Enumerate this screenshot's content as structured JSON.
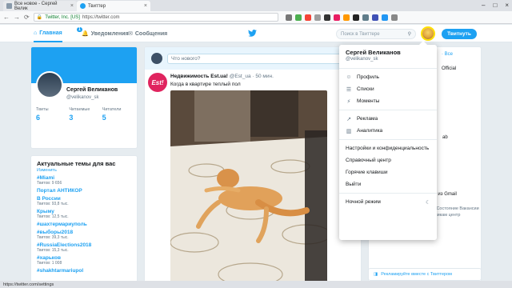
{
  "browser": {
    "tabs": [
      {
        "title": "Все новое - Сергей Велик",
        "active": false
      },
      {
        "title": "Твиттер",
        "active": true
      }
    ],
    "url_org": "Twitter, Inc. [US]",
    "url_path": "https://twitter.com"
  },
  "topnav": {
    "home": "Главная",
    "notifications": "Уведомления",
    "notifications_count": "1",
    "messages": "Сообщения",
    "search_placeholder": "Поиск в Твиттере",
    "tweet_button": "Твитнуть"
  },
  "profile": {
    "name": "Сергей Великанов",
    "handle": "@velikanov_sk",
    "stats": [
      {
        "label": "Твиты",
        "value": "6"
      },
      {
        "label": "Читаемые",
        "value": "3"
      },
      {
        "label": "Читатели",
        "value": "5"
      }
    ]
  },
  "trends": {
    "title": "Актуальные темы для вас",
    "change": "Изменить",
    "items": [
      {
        "tag": "#Miami",
        "count": "Твитов: 9 656"
      },
      {
        "tag": "Портал АНТИКОР",
        "count": ""
      },
      {
        "tag": "В России",
        "count": "Твитов: 93,8 тыс."
      },
      {
        "tag": "Крыму",
        "count": "Твитов: 12,5 тыс."
      },
      {
        "tag": "#шахтермариуполь",
        "count": ""
      },
      {
        "tag": "#выборы2018",
        "count": "Твитов: 39,3 тыс."
      },
      {
        "tag": "#RussiaElections2018",
        "count": "Твитов: 15,3 тыс."
      },
      {
        "tag": "#харьков",
        "count": "Твитов: 1 008"
      },
      {
        "tag": "#shakhtarmariupol",
        "count": ""
      }
    ]
  },
  "composer": {
    "placeholder": "Что нового?"
  },
  "tweet": {
    "author": "Недвижимость Est.ua!",
    "handle": "@Est_ua",
    "time": "· 50 мин.",
    "text": "Когда в квартире теплый пол",
    "avatar_text": "Est!"
  },
  "menu": {
    "name": "Сергей Великанов",
    "handle": "@velikanov_sk",
    "group1": [
      {
        "icon": "person-icon",
        "label": "Профиль"
      },
      {
        "icon": "list-icon",
        "label": "Списки"
      },
      {
        "icon": "moments-icon",
        "label": "Моменты"
      }
    ],
    "group2": [
      {
        "icon": "ads-icon",
        "label": "Реклама"
      },
      {
        "icon": "analytics-icon",
        "label": "Аналитика"
      }
    ],
    "group3": [
      "Настройки и конфиденциальность",
      "Справочный центр",
      "Горячие клавиши",
      "Выйти"
    ],
    "night_mode": "Ночной режим"
  },
  "right": {
    "frag1": "· Все",
    "frag2": "Official",
    "frag3": "ab",
    "frag4": "з из Gmail",
    "footer": "Файлы cookie   О Твиттере   Блог   Состояние   Вакансии   Маркетинг   Компании   Разработчикам   центр",
    "ad": "Рекламируйте вместе с Твиттером"
  },
  "statusbar": "https://twitter.com/settings"
}
